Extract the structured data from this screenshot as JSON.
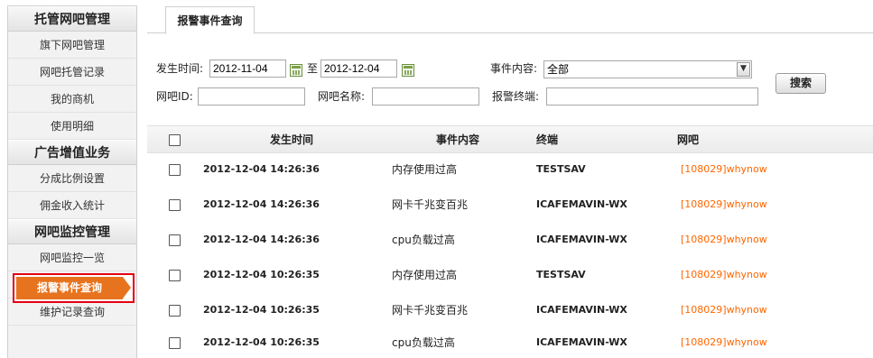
{
  "sidebar": {
    "sections": [
      {
        "title": "托管网吧管理",
        "items": [
          "旗下网吧管理",
          "网吧托管记录",
          "我的商机",
          "使用明细"
        ]
      },
      {
        "title": "广告增值业务",
        "items": [
          "分成比例设置",
          "佣金收入统计"
        ]
      },
      {
        "title": "网吧监控管理",
        "items": [
          "网吧监控一览",
          "报警事件查询",
          "维护记录查询"
        ]
      }
    ],
    "active_item": "报警事件查询"
  },
  "tab": {
    "label": "报警事件查询"
  },
  "filters": {
    "time_label": "发生时间:",
    "start_date": "2012-11-04",
    "to_label": "至",
    "end_date": "2012-12-04",
    "event_label": "事件内容:",
    "event_selected": "全部",
    "netbar_id_label": "网吧ID:",
    "netbar_id_value": "",
    "netbar_name_label": "网吧名称:",
    "netbar_name_value": "",
    "terminal_label": "报警终端:",
    "terminal_value": "",
    "search_button": "搜索"
  },
  "table": {
    "columns": [
      "发生时间",
      "事件内容",
      "终端",
      "网吧"
    ],
    "rows": [
      {
        "time": "2012-12-04 14:26:36",
        "event": "内存使用过高",
        "terminal": "TESTSAV",
        "netbar": "[108029]whynow"
      },
      {
        "time": "2012-12-04 14:26:36",
        "event": "网卡千兆变百兆",
        "terminal": "ICAFEMAVIN-WX",
        "netbar": "[108029]whynow"
      },
      {
        "time": "2012-12-04 14:26:36",
        "event": "cpu负载过高",
        "terminal": "ICAFEMAVIN-WX",
        "netbar": "[108029]whynow"
      },
      {
        "time": "2012-12-04 10:26:35",
        "event": "内存使用过高",
        "terminal": "TESTSAV",
        "netbar": "[108029]whynow"
      },
      {
        "time": "2012-12-04 10:26:35",
        "event": "网卡千兆变百兆",
        "terminal": "ICAFEMAVIN-WX",
        "netbar": "[108029]whynow"
      },
      {
        "time": "2012-12-04 10:26:35",
        "event": "cpu负载过高",
        "terminal": "ICAFEMAVIN-WX",
        "netbar": "[108029]whynow"
      }
    ]
  },
  "colors": {
    "accent": "#e8731e",
    "highlight_border": "#e60012",
    "link": "#ff6600"
  }
}
